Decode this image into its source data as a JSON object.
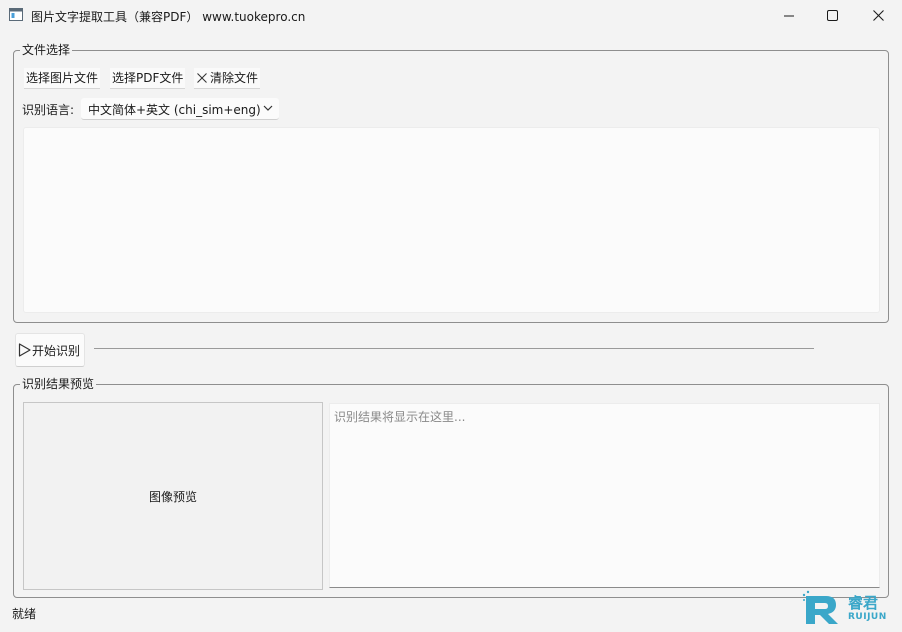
{
  "window": {
    "title": "图片文字提取工具（兼容PDF） www.tuokepro.cn"
  },
  "file_section": {
    "title": "文件选择",
    "select_image_label": "选择图片文件",
    "select_pdf_label": "选择PDF文件",
    "clear_label": "清除文件",
    "language_label": "识别语言:",
    "language_value": "中文简体+英文 (chi_sim+eng)"
  },
  "actions": {
    "start_label": "开始识别"
  },
  "result_section": {
    "title": "识别结果预览",
    "image_preview_label": "图像预览",
    "result_placeholder": "识别结果将显示在这里..."
  },
  "status": {
    "text": "就绪"
  },
  "watermark": {
    "name_cn": "睿君",
    "name_en": "RUIJUN"
  },
  "colors": {
    "accent": "#3aa7c9",
    "background": "#f3f3f3",
    "border": "#8e8e8e"
  },
  "icons": {
    "app": "app-window-icon",
    "minimize": "minimize-icon",
    "maximize": "maximize-icon",
    "close": "close-icon",
    "clear": "x-icon",
    "dropdown": "chevron-down-icon",
    "start": "play-icon"
  }
}
